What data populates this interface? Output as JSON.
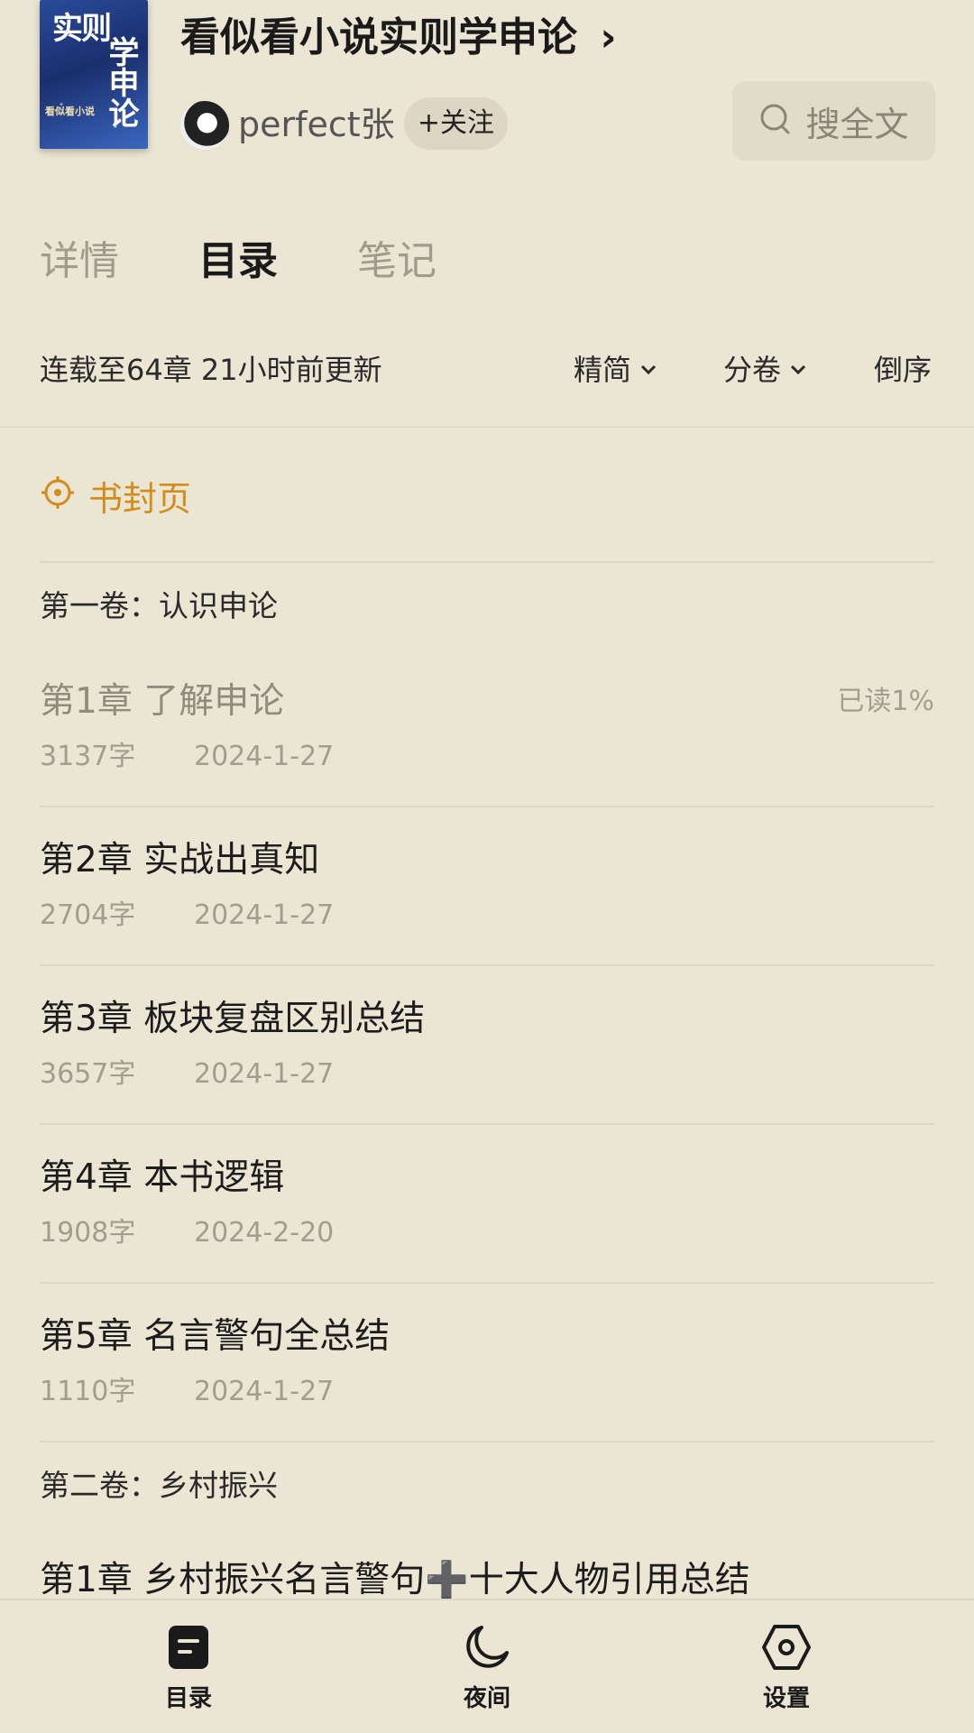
{
  "book": {
    "cover_text_line1": "实则",
    "cover_text_line2": "学申论",
    "cover_subtitle": "看似看小说",
    "title": "看似看小说实则学申论",
    "title_arrow": "›",
    "author": "perfect张",
    "follow_label": "+关注",
    "search_label": "搜全文"
  },
  "tabs": [
    {
      "label": "详情",
      "active": false
    },
    {
      "label": "目录",
      "active": true
    },
    {
      "label": "笔记",
      "active": false
    }
  ],
  "toolbar": {
    "status": "连载至64章 21小时前更新",
    "simplify_label": "精简",
    "volume_label": "分卷",
    "order_label": "倒序"
  },
  "cover_link": "书封页",
  "volumes": [
    {
      "title": "第一卷：认识申论",
      "chapters": [
        {
          "title": "第1章 了解申论",
          "words": "3137字",
          "date": "2024-1-27",
          "progress": "已读1%",
          "read": true
        },
        {
          "title": "第2章 实战出真知",
          "words": "2704字",
          "date": "2024-1-27"
        },
        {
          "title": "第3章 板块复盘区别总结",
          "words": "3657字",
          "date": "2024-1-27"
        },
        {
          "title": "第4章 本书逻辑",
          "words": "1908字",
          "date": "2024-2-20"
        },
        {
          "title": "第5章 名言警句全总结",
          "words": "1110字",
          "date": "2024-1-27"
        }
      ]
    },
    {
      "title": "第二卷：乡村振兴",
      "chapters": [
        {
          "title": "第1章 乡村振兴名言警句➕十大人物引用总结"
        }
      ]
    }
  ],
  "bottom_nav": [
    {
      "label": "目录",
      "icon": "catalog-icon"
    },
    {
      "label": "夜间",
      "icon": "moon-icon"
    },
    {
      "label": "设置",
      "icon": "settings-icon"
    }
  ],
  "colors": {
    "background": "#ebe5d3",
    "accent": "#d38d1c",
    "muted": "#a39d8f"
  }
}
